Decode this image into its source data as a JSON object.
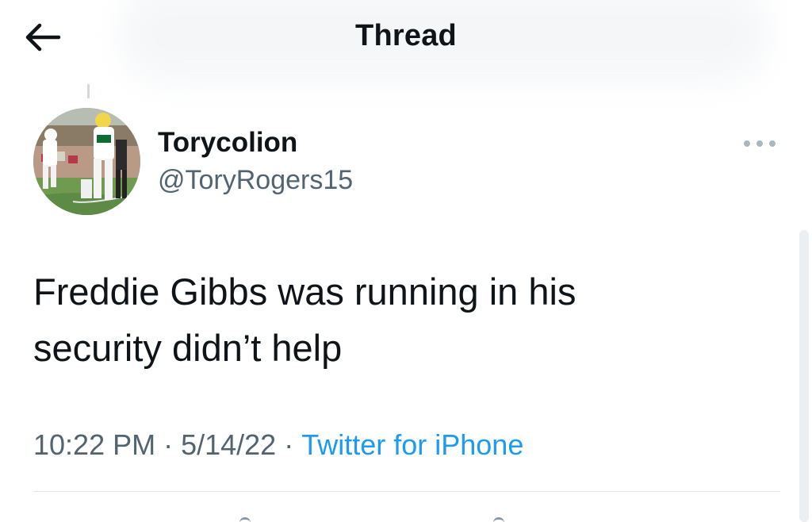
{
  "header": {
    "title": "Thread",
    "back_icon": "back-arrow-icon"
  },
  "tweet": {
    "author_name": "Torycolion",
    "author_handle": "@ToryRogers15",
    "avatar": "avatar-photo",
    "more_icon": "more-options-icon",
    "text": "Freddie Gibbs was running in his\nsecurity didn’t help",
    "time": "10:22 PM",
    "date": "5/14/22",
    "separator": "·",
    "source": "Twitter for iPhone"
  },
  "colors": {
    "text_primary": "#0f1419",
    "text_secondary": "#536471",
    "link": "#1d9bf0",
    "divider": "#dfe5e9"
  }
}
